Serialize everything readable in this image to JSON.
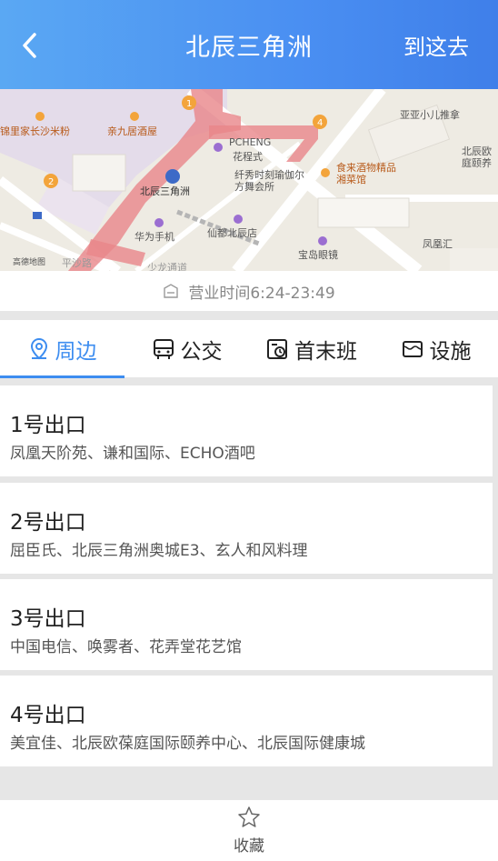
{
  "header": {
    "title": "北辰三角洲",
    "go_label": "到这去"
  },
  "map": {
    "labels": {
      "l1": "锦里家长沙米粉",
      "l2": "亲九居酒屋",
      "l3": "PCHENG",
      "l4": "花程式",
      "l5": "纤秀时刻瑜伽尔方舞会所",
      "l6": "食来酒物精品湘菜馆",
      "l7": "亚亚小儿推拿",
      "l8": "北辰欧庭颐养",
      "l9": "北辰三角洲",
      "l10": "华为手机",
      "l11": "仙都北辰店",
      "l12": "宝岛眼镜",
      "l13": "凤凰汇",
      "l14": "高德地图",
      "l15": "平沙路",
      "l16": "少龙通道"
    }
  },
  "hours": {
    "text": "营业时间6:24-23:49"
  },
  "tabs": [
    {
      "label": "周边"
    },
    {
      "label": "公交"
    },
    {
      "label": "首末班"
    },
    {
      "label": "设施"
    }
  ],
  "exits": [
    {
      "name": "1号出口",
      "desc": "凤凰天阶苑、谦和国际、ECHO酒吧"
    },
    {
      "name": "2号出口",
      "desc": "屈臣氏、北辰三角洲奥城E3、玄人和风料理"
    },
    {
      "name": "3号出口",
      "desc": "中国电信、唤雾者、花弄堂花艺馆"
    },
    {
      "name": "4号出口",
      "desc": "美宜佳、北辰欧葆庭国际颐养中心、北辰国际健康城"
    }
  ],
  "bottom": {
    "favorite_label": "收藏"
  },
  "colors": {
    "accent": "#3d8df0",
    "header_start": "#5aa8f3",
    "header_end": "#3f7fe9"
  }
}
